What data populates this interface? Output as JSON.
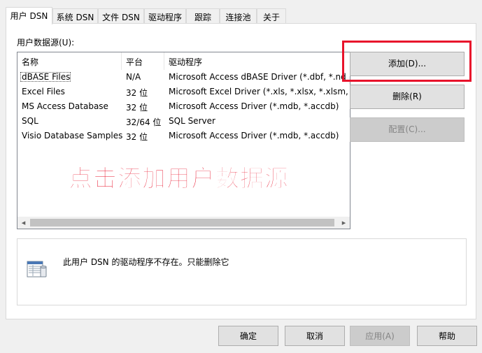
{
  "tabs": [
    {
      "label": "用户 DSN",
      "active": true
    },
    {
      "label": "系统 DSN",
      "active": false
    },
    {
      "label": "文件 DSN",
      "active": false
    },
    {
      "label": "驱动程序",
      "active": false
    },
    {
      "label": "跟踪",
      "active": false
    },
    {
      "label": "连接池",
      "active": false
    },
    {
      "label": "关于",
      "active": false
    }
  ],
  "user_dsn": {
    "list_title": "用户数据源(U):",
    "columns": {
      "name": "名称",
      "platform": "平台",
      "driver": "驱动程序"
    },
    "rows": [
      {
        "name": "dBASE Files",
        "platform": "N/A",
        "driver": "Microsoft Access dBASE Driver (*.dbf, *.nd"
      },
      {
        "name": "Excel Files",
        "platform": "32 位",
        "driver": "Microsoft Excel Driver (*.xls, *.xlsx, *.xlsm, *"
      },
      {
        "name": "MS Access Database",
        "platform": "32 位",
        "driver": "Microsoft Access Driver (*.mdb, *.accdb)"
      },
      {
        "name": "SQL",
        "platform": "32/64 位",
        "driver": "SQL Server"
      },
      {
        "name": "Visio Database Samples",
        "platform": "32 位",
        "driver": "Microsoft Access Driver (*.mdb, *.accdb)"
      }
    ],
    "overlay_annotation": "点击添加用户数据源",
    "buttons": {
      "add": "添加(D)...",
      "remove": "删除(R)",
      "configure": "配置(C)..."
    },
    "info_text": "此用户 DSN 的驱动程序不存在。只能删除它",
    "info_icon": "datasource-icon"
  },
  "dialog_buttons": {
    "ok": "确定",
    "cancel": "取消",
    "apply": "应用(A)",
    "help": "帮助"
  },
  "colors": {
    "annotation_red": "#e8132b",
    "window_bg": "#f0f0f0",
    "panel_bg": "#ffffff"
  }
}
